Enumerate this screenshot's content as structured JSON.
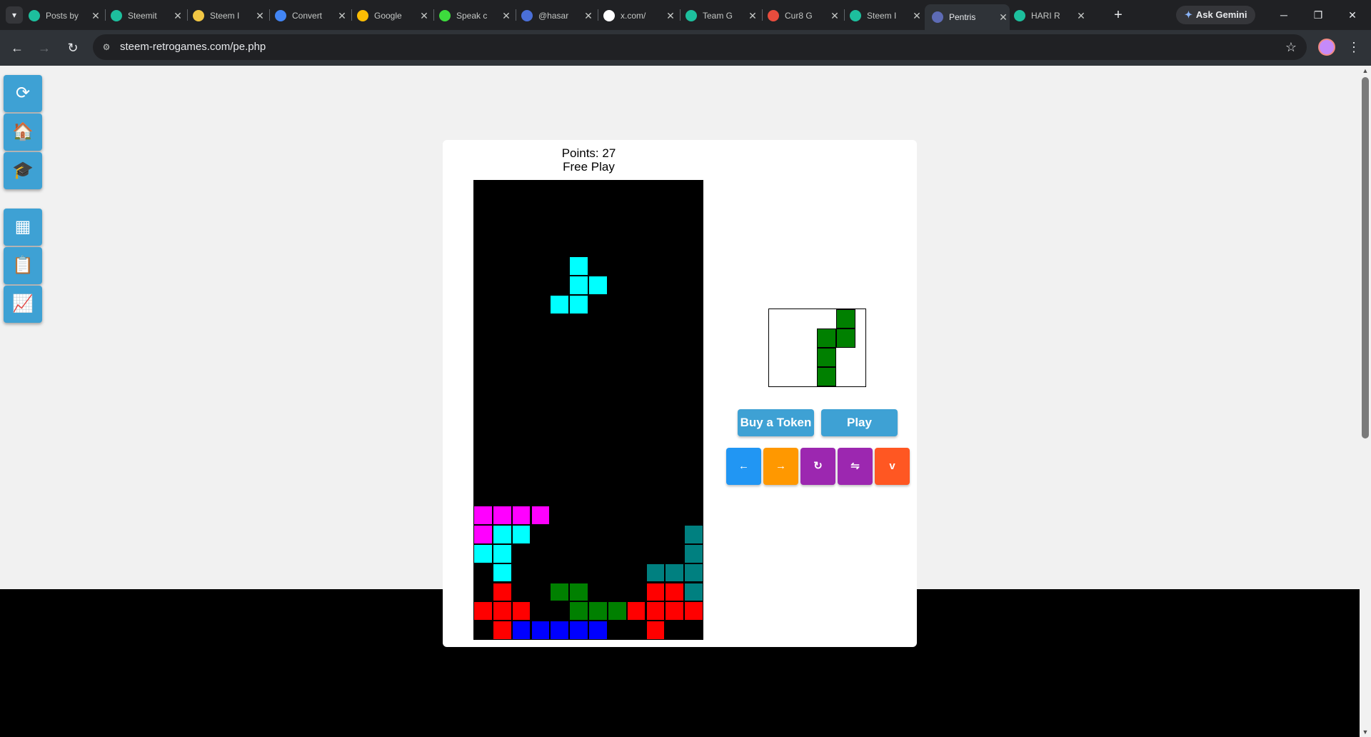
{
  "browser": {
    "tab_list_icon": "chevron-down-icon",
    "tabs": [
      {
        "title": "Posts by",
        "color": "#1dbf9d",
        "icon": "steemit-icon"
      },
      {
        "title": "Steemit",
        "color": "#1dbf9d",
        "icon": "steemit-icon"
      },
      {
        "title": "Steem I",
        "color": "#f2c744",
        "icon": "emoji-icon"
      },
      {
        "title": "Convert",
        "color": "#4285f4",
        "icon": "google-drive-icon"
      },
      {
        "title": "Google",
        "color": "#fbbc04",
        "icon": "lightbulb-icon"
      },
      {
        "title": "Speak c",
        "color": "#3ddc3d",
        "icon": "play-icon"
      },
      {
        "title": "@hasar",
        "color": "#4a6fd8",
        "icon": "profile-icon"
      },
      {
        "title": "x.com/",
        "color": "#ffffff",
        "icon": "x-icon"
      },
      {
        "title": "Team G",
        "color": "#1dbf9d",
        "icon": "steemit-icon"
      },
      {
        "title": "Cur8 G",
        "color": "#e84c3d",
        "icon": "cur8-icon"
      },
      {
        "title": "Steem I",
        "color": "#1dbf9d",
        "icon": "steem-icon"
      },
      {
        "title": "Pentris",
        "color": "#5d6bb5",
        "icon": "pentris-icon",
        "active": true
      },
      {
        "title": "HARI R",
        "color": "#1dbf9d",
        "icon": "hari-icon"
      }
    ],
    "close_glyph": "✕",
    "new_tab": "+",
    "ask_gemini": "Ask Gemini",
    "window_controls": {
      "minimize": "─",
      "restore": "❐",
      "close": "✕"
    },
    "url": "steem-retrogames.com/pe.php"
  },
  "sidebar": [
    {
      "name": "reload-icon",
      "glyph": "⟳"
    },
    {
      "name": "home-icon",
      "glyph": "🏠"
    },
    {
      "name": "graduation-cap-icon",
      "glyph": "🎓"
    },
    {
      "name": "grid-icon",
      "glyph": "▦"
    },
    {
      "name": "clipboard-icon",
      "glyph": "📋"
    },
    {
      "name": "chart-icon",
      "glyph": "📈"
    }
  ],
  "game": {
    "points_label": "Points: 27",
    "mode_label": "Free Play",
    "columns": 12,
    "rows": 24,
    "palette": {
      "C": "#00ffff",
      "M": "#ff00ff",
      "R": "#ff0000",
      "B": "#0000ff",
      "G": "#008000",
      "T": "#008080"
    },
    "falling_piece": {
      "color": "#00ffff",
      "cells": [
        [
          5,
          4
        ],
        [
          5,
          5
        ],
        [
          6,
          5
        ],
        [
          4,
          6
        ],
        [
          5,
          6
        ]
      ]
    },
    "board_rows": [
      "............",
      "............",
      "............",
      "............",
      "............",
      "............",
      "............",
      "............",
      "............",
      "............",
      "............",
      "............",
      "............",
      "............",
      "............",
      "............",
      "............",
      "MMMM........",
      "MCC........T",
      "CC.........T",
      ".C.......TTT",
      ".R..GG...RRT",
      "RRR..GGGRRRR",
      ".RBBBBB..R.."
    ],
    "next_piece": {
      "color": "#008000",
      "cells": [
        [
          2,
          0
        ],
        [
          2,
          1
        ],
        [
          1,
          1
        ],
        [
          1,
          2
        ],
        [
          1,
          3
        ]
      ]
    },
    "buy_token_label": "Buy a Token",
    "play_label": "Play",
    "controls": [
      {
        "name": "move-left-button",
        "label": "←",
        "color": "#2196f3"
      },
      {
        "name": "move-right-button",
        "label": "→",
        "color": "#ff9800"
      },
      {
        "name": "rotate-button",
        "label": "↻",
        "color": "#9c27b0"
      },
      {
        "name": "flip-button",
        "label": "⇋",
        "color": "#9c27b0"
      },
      {
        "name": "drop-button",
        "label": "v",
        "color": "#ff5722"
      }
    ]
  }
}
